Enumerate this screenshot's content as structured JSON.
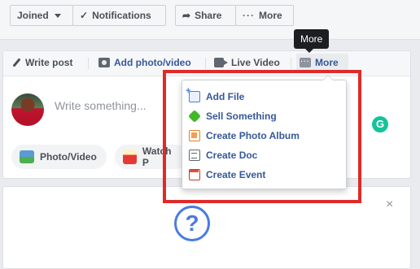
{
  "header": {
    "joined_label": "Joined",
    "notifications_label": "Notifications",
    "share_label": "Share",
    "more_label": "More"
  },
  "composer": {
    "tabs": {
      "write_post": "Write post",
      "add_photo_video": "Add photo/video",
      "live_video": "Live Video",
      "more": "More"
    },
    "placeholder": "Write something...",
    "actions": {
      "photo_video": "Photo/Video",
      "watch_party": "Watch P"
    }
  },
  "tooltip": {
    "text": "More"
  },
  "more_menu": {
    "items": [
      {
        "label": "Add File",
        "icon": "add-file-icon"
      },
      {
        "label": "Sell Something",
        "icon": "tag-icon"
      },
      {
        "label": "Create Photo Album",
        "icon": "photo-album-icon"
      },
      {
        "label": "Create Doc",
        "icon": "doc-icon"
      },
      {
        "label": "Create Event",
        "icon": "calendar-icon"
      }
    ]
  },
  "card2": {
    "close_symbol": "×",
    "help_symbol": "?"
  },
  "colors": {
    "link_blue": "#365899",
    "highlight_red": "#e02a2a",
    "grammarly_green": "#15c39a",
    "background": "#e9ebee"
  }
}
